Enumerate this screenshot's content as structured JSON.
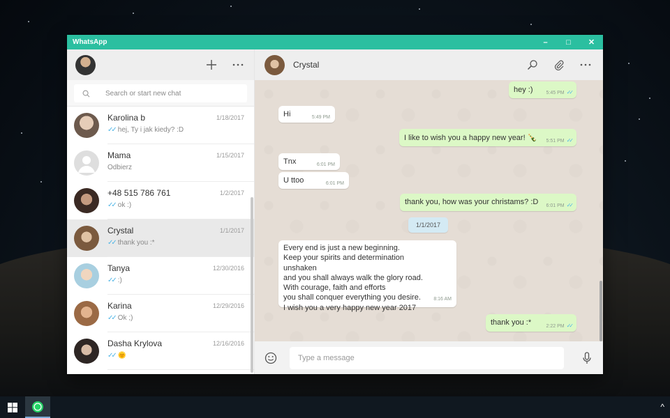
{
  "window": {
    "title": "WhatsApp",
    "controls": {
      "minimize": "–",
      "maximize": "□",
      "close": "✕"
    }
  },
  "sidebar": {
    "new_chat_icon": "plus-icon",
    "menu_icon": "more-horizontal-icon",
    "search": {
      "placeholder": "Search or start new chat"
    },
    "chats": [
      {
        "name": "Karolina b",
        "date": "1/18/2017",
        "preview": "hej, Ty i jak kiedy? :D",
        "ticks": "✓✓",
        "avatar_color": "#b89a88"
      },
      {
        "name": "Mama",
        "date": "1/15/2017",
        "preview": "Odbierz",
        "ticks": "",
        "avatar_color": "#d6d6d6"
      },
      {
        "name": "+48 515 786 761",
        "date": "1/2/2017",
        "preview": "ok :)",
        "ticks": "✓✓",
        "avatar_color": "#6e4a3c"
      },
      {
        "name": "Crystal",
        "date": "1/1/2017",
        "preview": "thank you :*",
        "ticks": "✓✓",
        "avatar_color": "#8a6a4e"
      },
      {
        "name": "Tanya",
        "date": "12/30/2016",
        "preview": ":)",
        "ticks": "✓✓",
        "avatar_color": "#c9b39c"
      },
      {
        "name": "Karina",
        "date": "12/29/2016",
        "preview": "Ok ;)",
        "ticks": "✓✓",
        "avatar_color": "#b07a55"
      },
      {
        "name": "Dasha Krylova",
        "date": "12/16/2016",
        "preview": "🌞",
        "ticks": "✓✓",
        "avatar_color": "#5a4a45"
      }
    ]
  },
  "conversation": {
    "contact_name": "Crystal",
    "icons": [
      "search-icon",
      "attach-icon",
      "more-horizontal-icon"
    ],
    "messages": [
      {
        "dir": "out",
        "text": "hey :)",
        "time": "5:45 PM",
        "ticks": "✓✓"
      },
      {
        "dir": "in",
        "text": "Hi",
        "time": "5:49 PM"
      },
      {
        "dir": "out",
        "text": "I like to wish you a happy new year! 🍾",
        "time": "5:51 PM",
        "ticks": "✓✓"
      },
      {
        "dir": "in",
        "text": "Tnx",
        "time": "6:01 PM"
      },
      {
        "dir": "in",
        "text": "U ttoo",
        "time": "6:01 PM"
      },
      {
        "dir": "out",
        "text": "thank you, how was your christams? :D",
        "time": "6:01 PM",
        "ticks": "✓✓"
      },
      {
        "dir": "in",
        "text": "Every end is just a new beginning.\nKeep your spirits and determination unshaken\nand you shall always walk the glory road.\nWith courage, faith and efforts\nyou shall conquer everything you desire.\nI wish you a very happy new year 2017",
        "time": "8:16 AM"
      },
      {
        "dir": "out",
        "text": "thank you :*",
        "time": "2:22 PM",
        "ticks": "✓✓"
      }
    ],
    "date_divider": "1/1/2017"
  },
  "composer": {
    "placeholder": "Type a message",
    "value": ""
  },
  "taskbar": {
    "tray_icon": "chevron-up-icon",
    "tray_glyph": "^"
  }
}
